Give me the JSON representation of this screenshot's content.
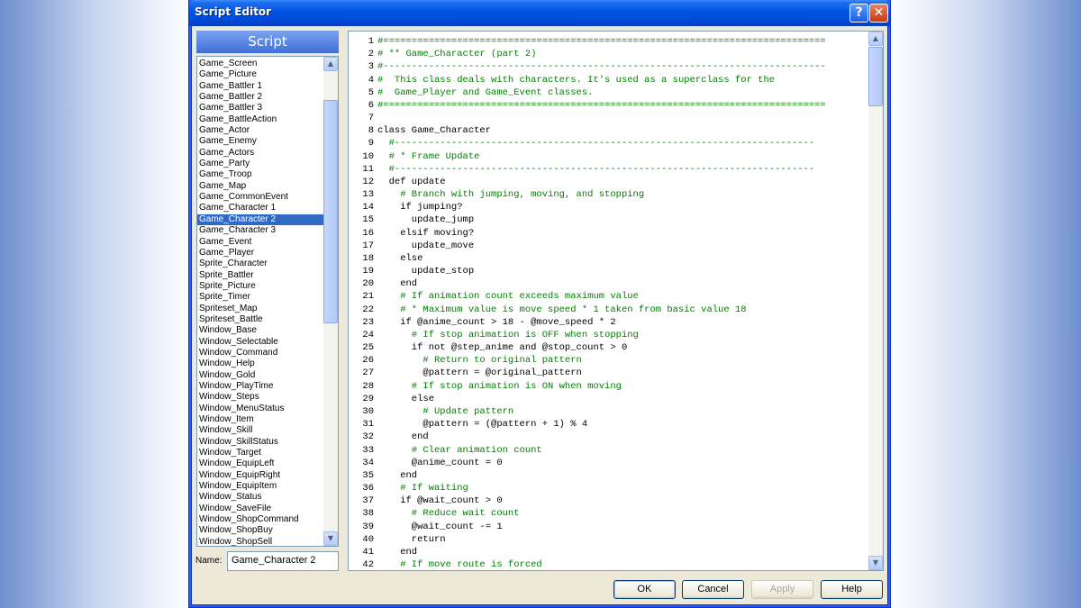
{
  "window": {
    "title": "Script Editor",
    "help_icon": "question-mark-icon",
    "close_icon": "close-icon",
    "help_glyph": "?",
    "close_glyph": "✕"
  },
  "sidebar": {
    "header": "Script",
    "scroll_up_glyph": "▲",
    "scroll_down_glyph": "▼",
    "items": [
      "Game_Screen",
      "Game_Picture",
      "Game_Battler 1",
      "Game_Battler 2",
      "Game_Battler 3",
      "Game_BattleAction",
      "Game_Actor",
      "Game_Enemy",
      "Game_Actors",
      "Game_Party",
      "Game_Troop",
      "Game_Map",
      "Game_CommonEvent",
      "Game_Character 1",
      "Game_Character 2",
      "Game_Character 3",
      "Game_Event",
      "Game_Player",
      "Sprite_Character",
      "Sprite_Battler",
      "Sprite_Picture",
      "Sprite_Timer",
      "Spriteset_Map",
      "Spriteset_Battle",
      "Window_Base",
      "Window_Selectable",
      "Window_Command",
      "Window_Help",
      "Window_Gold",
      "Window_PlayTime",
      "Window_Steps",
      "Window_MenuStatus",
      "Window_Item",
      "Window_Skill",
      "Window_SkillStatus",
      "Window_Target",
      "Window_EquipLeft",
      "Window_EquipRight",
      "Window_EquipItem",
      "Window_Status",
      "Window_SaveFile",
      "Window_ShopCommand",
      "Window_ShopBuy",
      "Window_ShopSell"
    ],
    "selected_item": "Game_Character 2",
    "name_label": "Name:",
    "name_value": "Game_Character 2"
  },
  "editor": {
    "lines": [
      "#==============================================================================",
      "# ** Game_Character (part 2)",
      "#------------------------------------------------------------------------------",
      "#  This class deals with characters. It's used as a superclass for the",
      "#  Game_Player and Game_Event classes.",
      "#==============================================================================",
      "",
      "class Game_Character",
      "  #--------------------------------------------------------------------------",
      "  # * Frame Update",
      "  #--------------------------------------------------------------------------",
      "  def update",
      "    # Branch with jumping, moving, and stopping",
      "    if jumping?",
      "      update_jump",
      "    elsif moving?",
      "      update_move",
      "    else",
      "      update_stop",
      "    end",
      "    # If animation count exceeds maximum value",
      "    # * Maximum value is move speed * 1 taken from basic value 18",
      "    if @anime_count > 18 - @move_speed * 2",
      "      # If stop animation is OFF when stopping",
      "      if not @step_anime and @stop_count > 0",
      "        # Return to original pattern",
      "        @pattern = @original_pattern",
      "      # If stop animation is ON when moving",
      "      else",
      "        # Update pattern",
      "        @pattern = (@pattern + 1) % 4",
      "      end",
      "      # Clear animation count",
      "      @anime_count = 0",
      "    end",
      "    # If waiting",
      "    if @wait_count > 0",
      "      # Reduce wait count",
      "      @wait_count -= 1",
      "      return",
      "    end",
      "    # If move route is forced"
    ]
  },
  "buttons": {
    "ok": "OK",
    "cancel": "Cancel",
    "apply": "Apply",
    "help": "Help"
  },
  "colors": {
    "selection": "#316ac5",
    "comment": "#008000",
    "titlebar": "#0054e3"
  }
}
